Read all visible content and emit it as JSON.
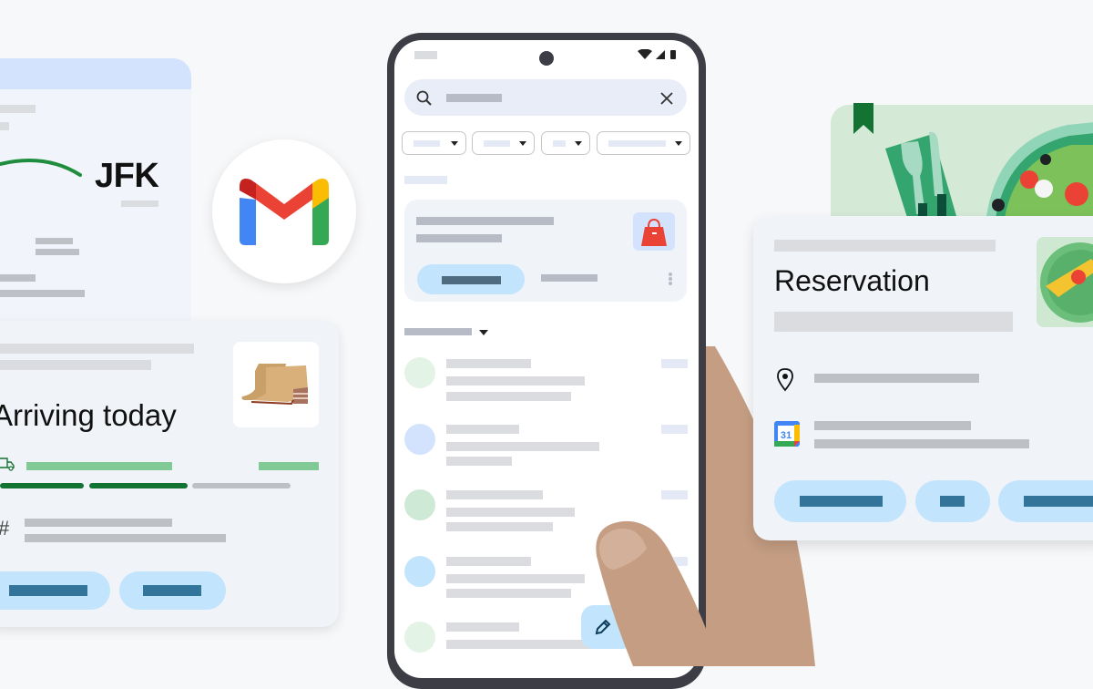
{
  "flight_card": {
    "destination": "JFK"
  },
  "gmail_logo": {
    "name": "Gmail",
    "colors": {
      "red": "#ea4335",
      "dark_red": "#c5221f",
      "blue": "#4285f4",
      "yellow": "#fbbc04",
      "green": "#34a853"
    }
  },
  "package_card": {
    "title": "Arriving today",
    "order_symbol": "#",
    "progress_steps_done": 2,
    "progress_steps_total": 3,
    "accent_green": "#137333",
    "light_green": "#81c995"
  },
  "phone": {
    "search": {
      "placeholder": ""
    },
    "filters": [
      "",
      "",
      "",
      ""
    ],
    "promo": {
      "accent": "#c2e5fd"
    },
    "inbox_rows": 5
  },
  "reservation_card": {
    "title": "Reservation",
    "calendar_day": "31"
  },
  "colors": {
    "button_bg": "#c2e5fd",
    "button_label": "#33749b",
    "skin": "#c49d82",
    "phone_frame": "#3c3d45"
  }
}
